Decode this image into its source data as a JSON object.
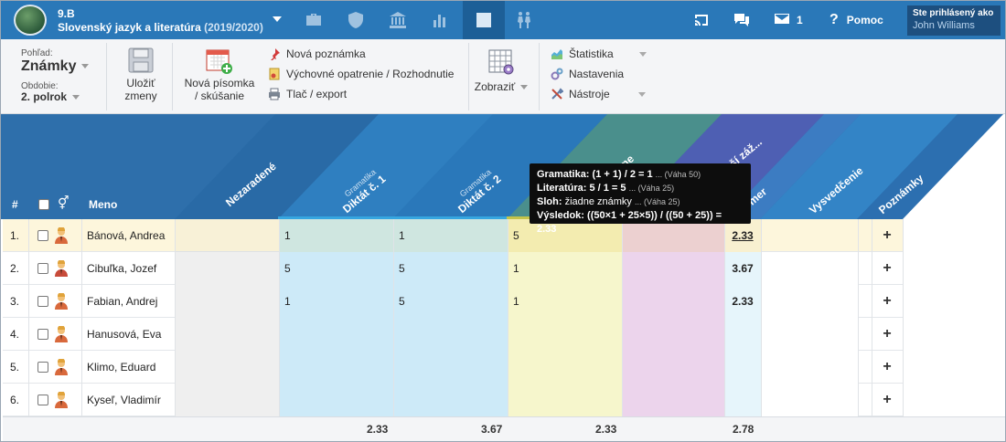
{
  "header": {
    "class_name": "9.B",
    "subject": "Slovenský jazyk a literatúra",
    "school_year": "(2019/2020)",
    "messages_count": "1",
    "help_label": "Pomoc",
    "login_label": "Ste prihlásený ako",
    "login_user": "John Williams"
  },
  "toolbar": {
    "view_label": "Pohľad:",
    "view_value": "Známky",
    "period_label": "Obdobie:",
    "period_value": "2. polrok",
    "save_line1": "Uložiť",
    "save_line2": "zmeny",
    "new_test_line1": "Nová písomka",
    "new_test_line2": "/ skúšanie",
    "new_note": "Nová poznámka",
    "measure": "Výchovné opatrenie / Rozhodnutie",
    "print": "Tlač / export",
    "display": "Zobraziť",
    "stats": "Štatistika",
    "settings": "Nastavenia",
    "tools": "Nástroje"
  },
  "table": {
    "col_num": "#",
    "col_gender": "⚥",
    "col_name": "Meno",
    "col_unassigned": "Nezaradené",
    "col_test1_group": "Gramatika",
    "col_test1": "Diktát č. 1",
    "col_test2_group": "Gramatika",
    "col_test2": "Diktát č. 2",
    "col_lit_frag": "asne",
    "col_sloh_frag": "epší záž...",
    "col_avg_frag": "riemer",
    "col_report": "Vysvedčenie",
    "col_notes": "Poznámky",
    "rows": [
      {
        "num": "1.",
        "name": "Bánová, Andrea",
        "g1": "1",
        "g2": "1",
        "lit": "5",
        "avg": "2.33"
      },
      {
        "num": "2.",
        "name": "Cibuľka, Jozef",
        "g1": "5",
        "g2": "5",
        "lit": "1",
        "avg": "3.67"
      },
      {
        "num": "3.",
        "name": "Fabian, Andrej",
        "g1": "1",
        "g2": "5",
        "lit": "1",
        "avg": "2.33"
      },
      {
        "num": "4.",
        "name": "Hanusová, Eva",
        "g1": "",
        "g2": "",
        "lit": "",
        "avg": ""
      },
      {
        "num": "5.",
        "name": "Klimo, Eduard",
        "g1": "",
        "g2": "",
        "lit": "",
        "avg": ""
      },
      {
        "num": "6.",
        "name": "Kyseľ, Vladimír",
        "g1": "",
        "g2": "",
        "lit": "",
        "avg": ""
      }
    ],
    "plus": "+",
    "footer": {
      "g1": "2.33",
      "g2": "3.67",
      "lit": "2.33",
      "avg": "2.78"
    }
  },
  "tooltip": {
    "l1_label": "Gramatika:",
    "l1_text": "(1 + 1) / 2 = 1",
    "l1_weight": "... (Váha 50)",
    "l2_label": "Literatúra:",
    "l2_text": "5 / 1 = 5",
    "l2_weight": "... (Váha 25)",
    "l3_label": "Sloh:",
    "l3_text": "žiadne známky",
    "l3_weight": "... (Váha 25)",
    "l4_label": "Výsledok:",
    "l4_text": "((50×1 + 25×5)) / ((50 + 25)) = 2.33"
  },
  "colors": {
    "topbar": "#2a78b8",
    "grammar": "#cdeaf8",
    "literature": "#f6f6cc",
    "sloh": "#ecd4ec",
    "avg": "#e6f5fb"
  }
}
